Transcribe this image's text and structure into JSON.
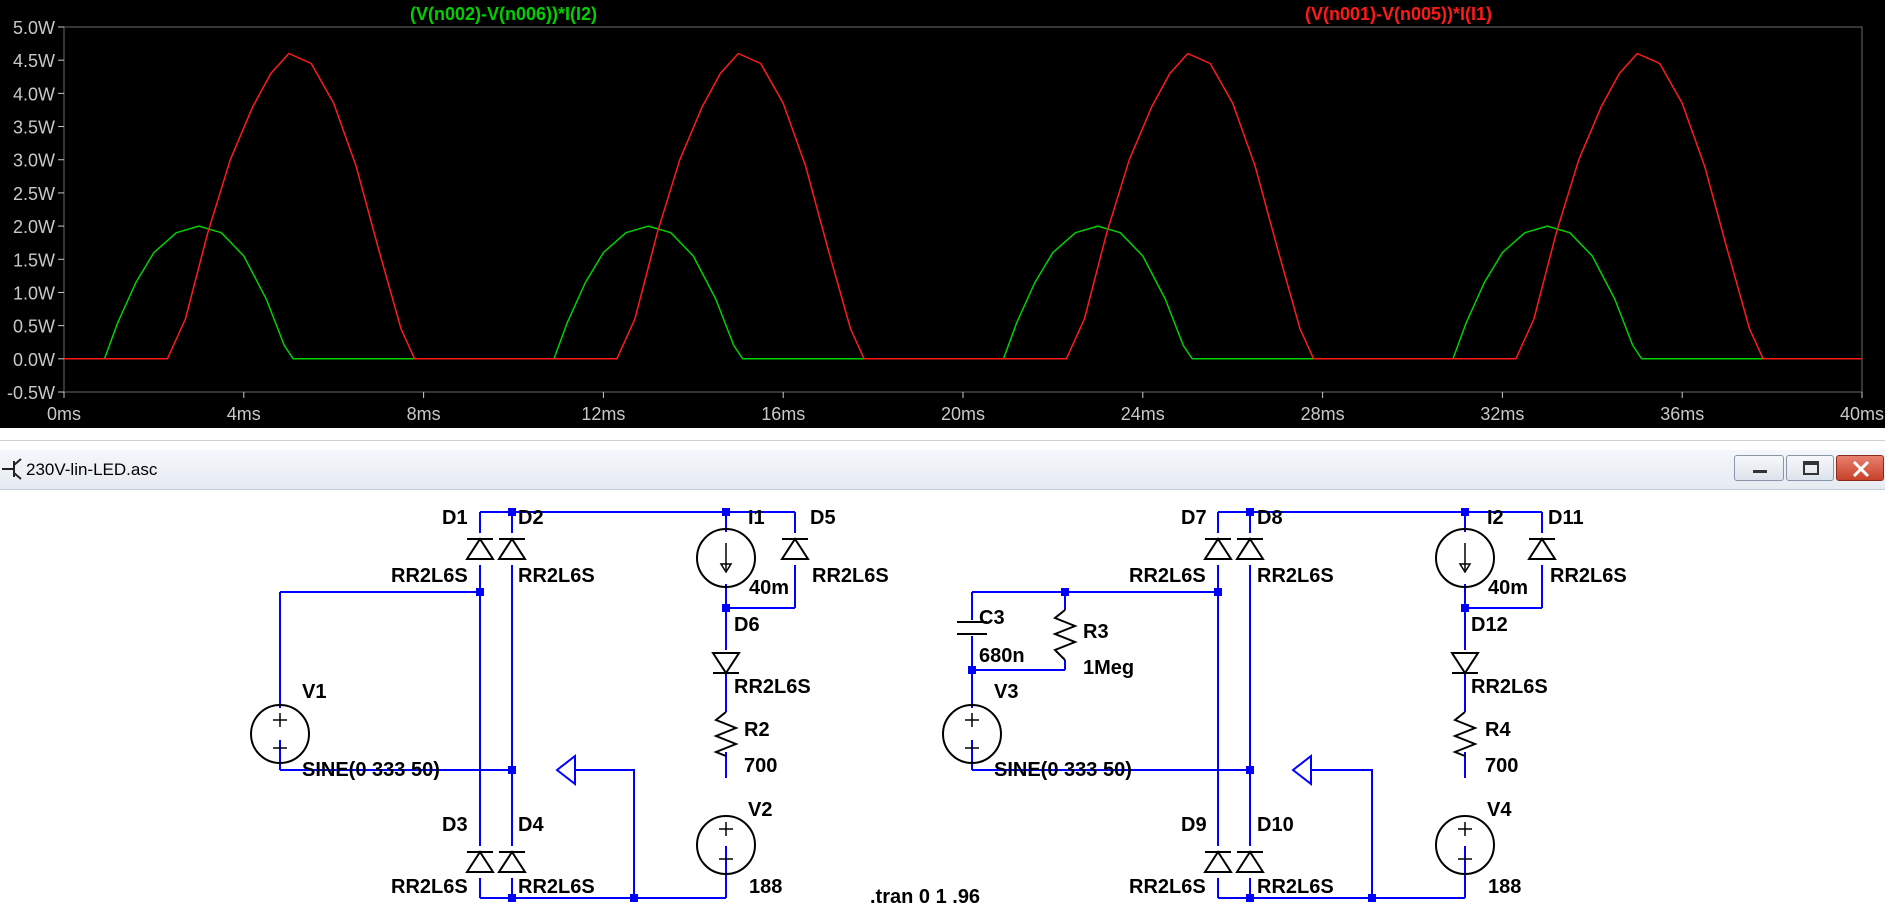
{
  "window": {
    "title": "230V-lin-LED.asc",
    "buttons": {
      "minimize": "minimize-icon",
      "maximize": "maximize-icon",
      "close": "close-icon"
    }
  },
  "colors": {
    "plot_bg": "#000000",
    "trace_green": "#00d000",
    "trace_red": "#ff1a1a",
    "grid": "#6a6a6a",
    "wire": "#0000ff",
    "junction": "#0000ff"
  },
  "chart_data": {
    "type": "line",
    "x_unit": "ms",
    "xlim": [
      0,
      40
    ],
    "ylim": [
      -0.5,
      5.0
    ],
    "x_ticks": [
      "0ms",
      "4ms",
      "8ms",
      "12ms",
      "16ms",
      "20ms",
      "24ms",
      "28ms",
      "32ms",
      "36ms",
      "40ms"
    ],
    "y_ticks": [
      "5.0W",
      "4.5W",
      "4.0W",
      "3.5W",
      "3.0W",
      "2.5W",
      "2.0W",
      "1.5W",
      "1.0W",
      "0.5W",
      "0.0W",
      "-0.5W"
    ],
    "series": [
      {
        "name": "(V(n002)-V(n006))*I(I2)",
        "color": "#00d000",
        "x": [
          0,
          0.9,
          1.2,
          1.6,
          2.0,
          2.5,
          3.0,
          3.5,
          4.0,
          4.5,
          4.9,
          5.1,
          10.9,
          11.2,
          11.6,
          12.0,
          12.5,
          13.0,
          13.5,
          14.0,
          14.5,
          14.9,
          15.1,
          20.9,
          21.2,
          21.6,
          22.0,
          22.5,
          23.0,
          23.5,
          24.0,
          24.5,
          24.9,
          25.1,
          30.9,
          31.2,
          31.6,
          32.0,
          32.5,
          33.0,
          33.5,
          34.0,
          34.5,
          34.9,
          35.1,
          40
        ],
        "y": [
          0,
          0,
          0.55,
          1.15,
          1.6,
          1.9,
          2.0,
          1.9,
          1.55,
          0.9,
          0.2,
          0,
          0,
          0.55,
          1.15,
          1.6,
          1.9,
          2.0,
          1.9,
          1.55,
          0.9,
          0.2,
          0,
          0,
          0.55,
          1.15,
          1.6,
          1.9,
          2.0,
          1.9,
          1.55,
          0.9,
          0.2,
          0,
          0,
          0.55,
          1.15,
          1.6,
          1.9,
          2.0,
          1.9,
          1.55,
          0.9,
          0.2,
          0,
          0
        ]
      },
      {
        "name": "(V(n001)-V(n005))*I(I1)",
        "color": "#ff1a1a",
        "x": [
          0,
          2.3,
          2.7,
          3.2,
          3.7,
          4.2,
          4.6,
          5.0,
          5.5,
          6.0,
          6.5,
          7.0,
          7.5,
          7.8,
          12.3,
          12.7,
          13.2,
          13.7,
          14.2,
          14.6,
          15.0,
          15.5,
          16.0,
          16.5,
          17.0,
          17.5,
          17.8,
          22.3,
          22.7,
          23.2,
          23.7,
          24.2,
          24.6,
          25.0,
          25.5,
          26.0,
          26.5,
          27.0,
          27.5,
          27.8,
          32.3,
          32.7,
          33.2,
          33.7,
          34.2,
          34.6,
          35.0,
          35.5,
          36.0,
          36.5,
          37.0,
          37.5,
          37.8,
          40
        ],
        "y": [
          0,
          0,
          0.6,
          1.9,
          3.0,
          3.8,
          4.3,
          4.6,
          4.45,
          3.85,
          2.9,
          1.65,
          0.45,
          0,
          0,
          0.6,
          1.9,
          3.0,
          3.8,
          4.3,
          4.6,
          4.45,
          3.85,
          2.9,
          1.65,
          0.45,
          0,
          0,
          0.6,
          1.9,
          3.0,
          3.8,
          4.3,
          4.6,
          4.45,
          3.85,
          2.9,
          1.65,
          0.45,
          0,
          0,
          0.6,
          1.9,
          3.0,
          3.8,
          4.3,
          4.6,
          4.45,
          3.85,
          2.9,
          1.65,
          0.45,
          0,
          0
        ]
      }
    ]
  },
  "schematic": {
    "left": {
      "d1": "D1",
      "d2": "D2",
      "d3": "D3",
      "d4": "D4",
      "d5": "D5",
      "d6": "D6",
      "i1": "I1",
      "i1_val": "40m",
      "r2": "R2",
      "r2_val": "700",
      "v1": "V1",
      "v1_val": "SINE(0 333 50)",
      "v2": "V2",
      "v2_val": "188",
      "d1_model": "RR2L6S",
      "d2_model": "RR2L6S",
      "d3_model": "RR2L6S",
      "d4_model": "RR2L6S",
      "d5_model": "RR2L6S",
      "d6_model": "RR2L6S"
    },
    "right": {
      "d7": "D7",
      "d8": "D8",
      "d9": "D9",
      "d10": "D10",
      "d11": "D11",
      "d12": "D12",
      "i2": "I2",
      "i2_val": "40m",
      "r3": "R3",
      "r3_val": "1Meg",
      "r4": "R4",
      "r4_val": "700",
      "c3": "C3",
      "c3_val": "680n",
      "v3": "V3",
      "v3_val": "SINE(0 333 50)",
      "v4": "V4",
      "v4_val": "188",
      "d7_model": "RR2L6S",
      "d8_model": "RR2L6S",
      "d9_model": "RR2L6S",
      "d10_model": "RR2L6S",
      "d11_model": "RR2L6S",
      "d12_model": "RR2L6S"
    },
    "directive": ".tran 0 1 .96"
  }
}
